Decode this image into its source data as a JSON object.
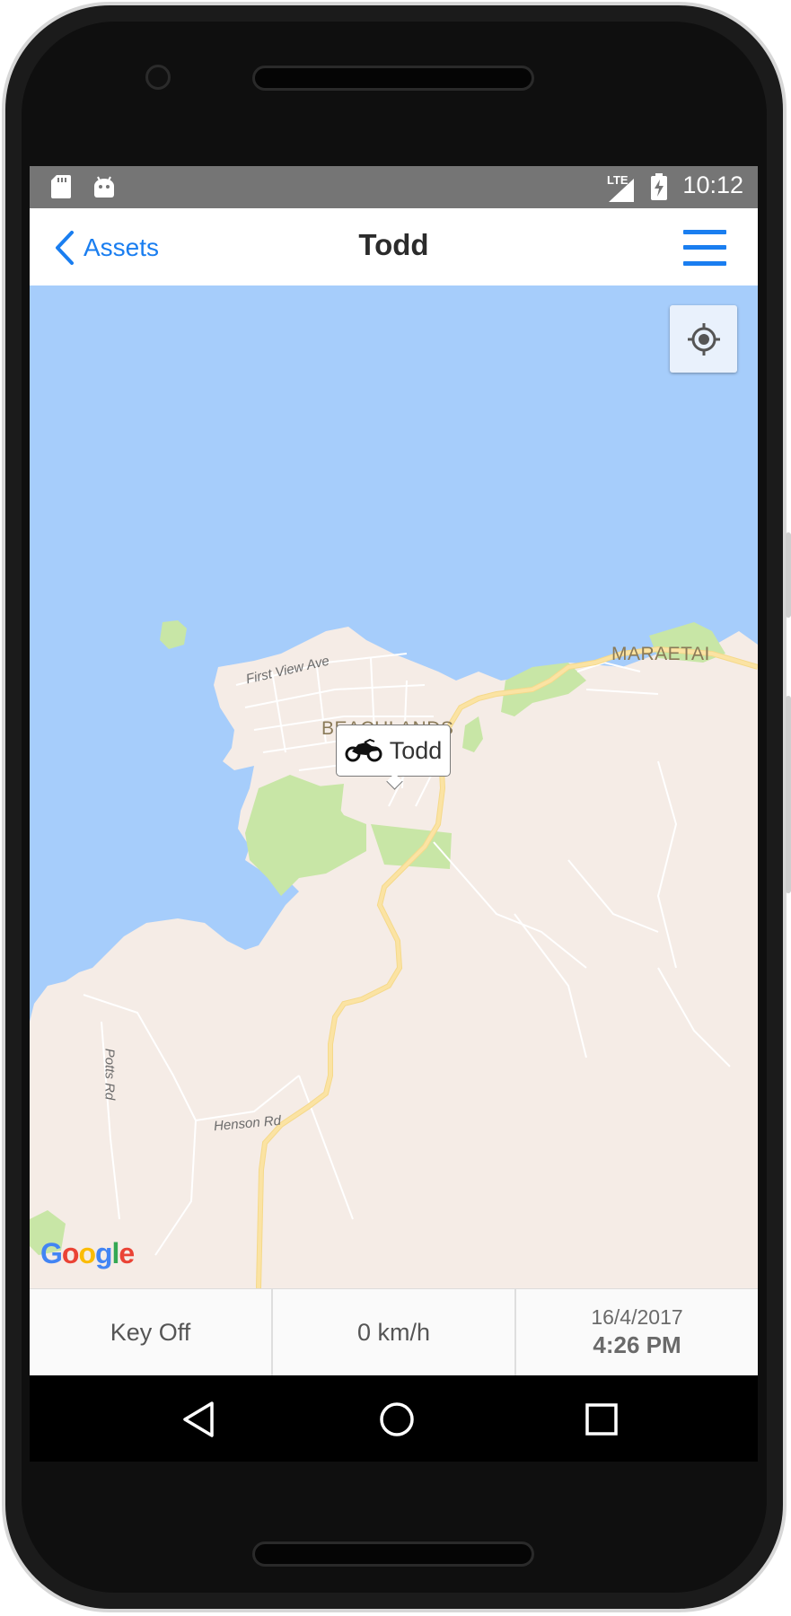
{
  "status_bar": {
    "time": "10:12",
    "network_label": "LTE",
    "icons": [
      "sd-card-icon",
      "android-icon",
      "signal-icon",
      "battery-charging-icon"
    ]
  },
  "app_bar": {
    "back_label": "Assets",
    "title": "Todd",
    "menu_icon": "hamburger-menu-icon",
    "accent_color": "#1a7ef0"
  },
  "map": {
    "locate_icon": "my-location-icon",
    "marker": {
      "icon": "motorcycle-icon",
      "label": "Todd"
    },
    "places": [
      "MARAETAI",
      "BEACHLANDS"
    ],
    "roads": [
      "First View Ave",
      "Potts Rd",
      "Henson Rd"
    ],
    "attribution": "Google",
    "colors": {
      "water": "#a6cdfb",
      "land": "#f5ece6",
      "park": "#c8e6a6",
      "road": "#fbe3a3"
    }
  },
  "info_bar": {
    "ignition": "Key Off",
    "speed": "0 km/h",
    "date": "16/4/2017",
    "time": "4:26 PM"
  },
  "nav_bar": {
    "buttons": [
      "back-triangle-icon",
      "home-circle-icon",
      "recents-square-icon"
    ]
  }
}
